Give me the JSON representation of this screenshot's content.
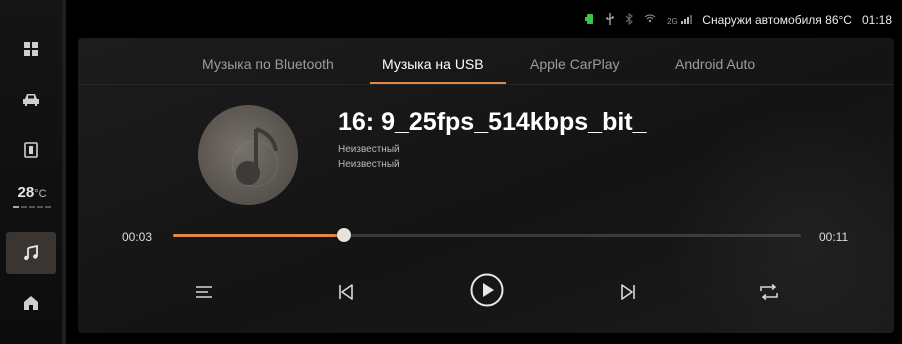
{
  "status_bar": {
    "outside_label": "Снаружи автомобиля",
    "outside_temp": "86°C",
    "time": "01:18",
    "signal_tag": "2G",
    "icons": [
      "phone-connected-icon",
      "usb-icon",
      "bluetooth-icon",
      "wifi-icon",
      "signal-icon"
    ],
    "accent_green": "#3cc34a"
  },
  "sidebar": {
    "items": [
      {
        "name": "apps-grid-icon"
      },
      {
        "name": "car-icon"
      },
      {
        "name": "phone-card-icon"
      },
      {
        "name": "music-note-icon",
        "active": true
      },
      {
        "name": "home-icon"
      }
    ],
    "climate": {
      "temp": "28",
      "unit": "°C"
    }
  },
  "source_tabs": [
    {
      "label": "Музыка по Bluetooth",
      "active": false
    },
    {
      "label": "Музыка на USB",
      "active": true
    },
    {
      "label": "Apple CarPlay",
      "active": false
    },
    {
      "label": "Android Auto",
      "active": false
    }
  ],
  "track": {
    "title": "16: 9_25fps_514kbps_bit_",
    "artist": "Неизвестный",
    "album": "Неизвестный"
  },
  "progress": {
    "current": "00:03",
    "total": "00:11",
    "fraction": 0.273
  },
  "controls": [
    "playlist-icon",
    "previous-icon",
    "play-icon",
    "next-icon",
    "repeat-icon"
  ],
  "accent_color": "#e0874a"
}
